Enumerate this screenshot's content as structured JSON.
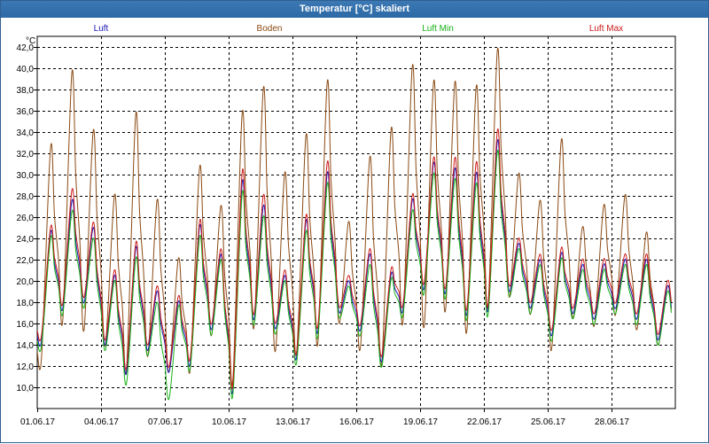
{
  "window": {
    "title": "Temperatur [°C] skaliert"
  },
  "chart_data": {
    "type": "line",
    "title": "Temperatur [°C] skaliert",
    "ylabel": "°C",
    "xlabel": "",
    "ylim": [
      8.0,
      43.0
    ],
    "xlim": [
      "2017-06-01 00:00",
      "2017-07-01 00:00"
    ],
    "grid": true,
    "legend_position": "top",
    "yticks": [
      10.0,
      12.0,
      14.0,
      16.0,
      18.0,
      20.0,
      22.0,
      24.0,
      26.0,
      28.0,
      30.0,
      32.0,
      34.0,
      36.0,
      38.0,
      40.0,
      42.0
    ],
    "ytick_labels": [
      "10,0",
      "12,0",
      "14,0",
      "16,0",
      "18,0",
      "20,0",
      "22,0",
      "24,0",
      "26,0",
      "28,0",
      "30,0",
      "32,0",
      "34,0",
      "36,0",
      "38,0",
      "40,0",
      "42,0"
    ],
    "xticks": [
      "2017-06-01",
      "2017-06-04",
      "2017-06-07",
      "2017-06-10",
      "2017-06-13",
      "2017-06-16",
      "2017-06-19",
      "2017-06-22",
      "2017-06-25",
      "2017-06-28"
    ],
    "xtick_labels": [
      "01.06.17",
      "04.06.17",
      "07.06.17",
      "10.06.17",
      "13.06.17",
      "16.06.17",
      "19.06.17",
      "22.06.17",
      "25.06.17",
      "28.06.17"
    ],
    "day_index_starts": "2017-06-01",
    "daily_min_max": {
      "x": [
        "2017-06-01",
        "2017-06-02",
        "2017-06-03",
        "2017-06-04",
        "2017-06-05",
        "2017-06-06",
        "2017-06-07",
        "2017-06-08",
        "2017-06-09",
        "2017-06-10",
        "2017-06-11",
        "2017-06-12",
        "2017-06-13",
        "2017-06-14",
        "2017-06-15",
        "2017-06-16",
        "2017-06-17",
        "2017-06-18",
        "2017-06-19",
        "2017-06-20",
        "2017-06-21",
        "2017-06-22",
        "2017-06-23",
        "2017-06-24",
        "2017-06-25",
        "2017-06-26",
        "2017-06-27",
        "2017-06-28",
        "2017-06-29",
        "2017-06-30"
      ]
    },
    "series": [
      {
        "name": "Luft",
        "color": "#1a1ab4",
        "min": [
          14.5,
          17.5,
          18.0,
          14.0,
          11.5,
          13.5,
          11.5,
          12.5,
          15.5,
          10.0,
          16.5,
          15.5,
          13.0,
          15.5,
          17.0,
          15.5,
          12.5,
          17.5,
          19.5,
          19.0,
          17.0,
          17.5,
          19.0,
          17.5,
          15.0,
          17.0,
          16.5,
          17.5,
          16.5,
          14.5
        ],
        "max": [
          24.5,
          27.5,
          25.0,
          20.5,
          23.0,
          19.0,
          18.0,
          25.0,
          22.5,
          29.0,
          27.0,
          20.5,
          25.5,
          30.0,
          20.0,
          22.5,
          20.5,
          27.5,
          31.0,
          30.5,
          30.0,
          33.0,
          23.5,
          22.0,
          22.5,
          21.5,
          21.5,
          22.0,
          22.0,
          19.5
        ]
      },
      {
        "name": "Boden",
        "color": "#8b4a13",
        "min": [
          13.0,
          16.5,
          15.5,
          14.0,
          12.0,
          13.0,
          11.5,
          12.0,
          15.0,
          11.0,
          16.0,
          13.5,
          13.5,
          14.5,
          16.0,
          14.0,
          12.5,
          16.5,
          16.0,
          17.5,
          15.5,
          18.0,
          18.5,
          17.0,
          14.0,
          16.5,
          16.0,
          17.0,
          15.5,
          14.0
        ],
        "max": [
          32.5,
          39.5,
          34.0,
          28.0,
          35.5,
          27.5,
          22.0,
          30.5,
          27.0,
          35.5,
          38.0,
          30.0,
          33.5,
          38.5,
          25.5,
          31.5,
          34.0,
          40.0,
          38.5,
          38.5,
          38.0,
          41.5,
          30.0,
          27.5,
          33.0,
          25.0,
          27.0,
          28.0,
          24.5,
          19.5
        ]
      },
      {
        "name": "Luft Min",
        "color": "#16b016",
        "min": [
          14.0,
          17.0,
          17.5,
          13.5,
          10.5,
          13.0,
          9.0,
          12.0,
          15.0,
          9.5,
          16.0,
          15.0,
          12.5,
          15.0,
          16.5,
          15.0,
          12.0,
          17.0,
          19.0,
          18.5,
          16.5,
          17.0,
          18.5,
          17.0,
          14.5,
          16.5,
          16.0,
          17.0,
          16.0,
          14.0
        ],
        "max": [
          24.0,
          26.5,
          24.0,
          20.0,
          22.0,
          18.0,
          17.5,
          24.0,
          22.0,
          28.0,
          26.0,
          20.0,
          24.5,
          29.0,
          19.5,
          21.5,
          20.0,
          26.5,
          30.0,
          29.5,
          29.0,
          32.0,
          23.0,
          21.5,
          22.0,
          21.0,
          21.0,
          21.5,
          21.5,
          19.0
        ]
      },
      {
        "name": "Luft Max",
        "color": "#cc1a1a",
        "min": [
          15.0,
          18.0,
          18.5,
          14.5,
          12.0,
          14.0,
          12.0,
          13.0,
          16.0,
          10.5,
          17.0,
          16.0,
          13.5,
          16.0,
          17.5,
          16.0,
          13.0,
          18.0,
          20.0,
          19.5,
          17.5,
          18.0,
          19.5,
          18.0,
          15.5,
          17.5,
          17.0,
          18.0,
          17.0,
          15.0
        ],
        "max": [
          25.0,
          28.5,
          25.5,
          21.0,
          23.5,
          19.5,
          18.5,
          25.5,
          23.0,
          30.0,
          28.0,
          21.0,
          26.0,
          31.0,
          20.5,
          23.0,
          21.0,
          28.0,
          31.5,
          31.5,
          31.0,
          34.0,
          24.0,
          22.5,
          23.0,
          22.0,
          22.0,
          22.5,
          22.5,
          20.0
        ]
      }
    ]
  }
}
